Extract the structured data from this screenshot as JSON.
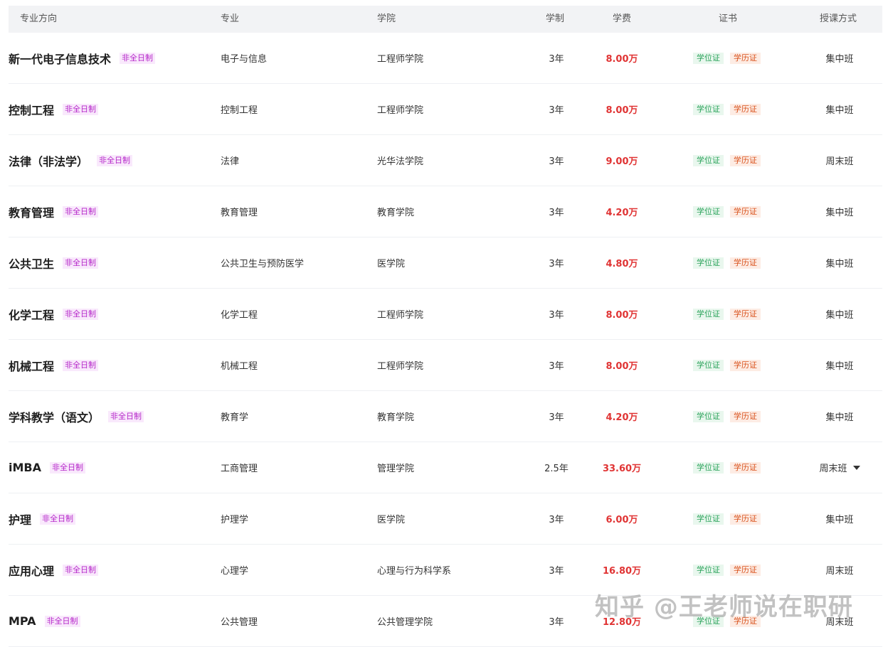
{
  "headers": {
    "direction": "专业方向",
    "major": "专业",
    "college": "学院",
    "years": "学制",
    "fee": "学费",
    "cert": "证书",
    "mode": "授课方式"
  },
  "rows": [
    {
      "direction": "新一代电子信息技术",
      "type": "非全日制",
      "major": "电子与信息",
      "college": "工程师学院",
      "years": "3年",
      "fee": "8.00万",
      "degree": "学位证",
      "edu": "学历证",
      "mode": "集中班"
    },
    {
      "direction": "控制工程",
      "type": "非全日制",
      "major": "控制工程",
      "college": "工程师学院",
      "years": "3年",
      "fee": "8.00万",
      "degree": "学位证",
      "edu": "学历证",
      "mode": "集中班"
    },
    {
      "direction": "法律（非法学）",
      "type": "非全日制",
      "major": "法律",
      "college": "光华法学院",
      "years": "3年",
      "fee": "9.00万",
      "degree": "学位证",
      "edu": "学历证",
      "mode": "周末班"
    },
    {
      "direction": "教育管理",
      "type": "非全日制",
      "major": "教育管理",
      "college": "教育学院",
      "years": "3年",
      "fee": "4.20万",
      "degree": "学位证",
      "edu": "学历证",
      "mode": "集中班"
    },
    {
      "direction": "公共卫生",
      "type": "非全日制",
      "major": "公共卫生与预防医学",
      "college": "医学院",
      "years": "3年",
      "fee": "4.80万",
      "degree": "学位证",
      "edu": "学历证",
      "mode": "集中班"
    },
    {
      "direction": "化学工程",
      "type": "非全日制",
      "major": "化学工程",
      "college": "工程师学院",
      "years": "3年",
      "fee": "8.00万",
      "degree": "学位证",
      "edu": "学历证",
      "mode": "集中班"
    },
    {
      "direction": "机械工程",
      "type": "非全日制",
      "major": "机械工程",
      "college": "工程师学院",
      "years": "3年",
      "fee": "8.00万",
      "degree": "学位证",
      "edu": "学历证",
      "mode": "集中班"
    },
    {
      "direction": "学科教学（语文）",
      "type": "非全日制",
      "major": "教育学",
      "college": "教育学院",
      "years": "3年",
      "fee": "4.20万",
      "degree": "学位证",
      "edu": "学历证",
      "mode": "集中班"
    },
    {
      "direction": "iMBA",
      "type": "非全日制",
      "major": "工商管理",
      "college": "管理学院",
      "years": "2.5年",
      "fee": "33.60万",
      "degree": "学位证",
      "edu": "学历证",
      "mode": "周末班",
      "dropdown": true
    },
    {
      "direction": "护理",
      "type": "非全日制",
      "major": "护理学",
      "college": "医学院",
      "years": "3年",
      "fee": "6.00万",
      "degree": "学位证",
      "edu": "学历证",
      "mode": "集中班"
    },
    {
      "direction": "应用心理",
      "type": "非全日制",
      "major": "心理学",
      "college": "心理与行为科学系",
      "years": "3年",
      "fee": "16.80万",
      "degree": "学位证",
      "edu": "学历证",
      "mode": "周末班"
    },
    {
      "direction": "MPA",
      "type": "非全日制",
      "major": "公共管理",
      "college": "公共管理学院",
      "years": "3年",
      "fee": "12.80万",
      "degree": "学位证",
      "edu": "学历证",
      "mode": "周末班"
    }
  ],
  "watermark": "知乎 @王老师说在职研",
  "colors": {
    "fee": "#e03434",
    "type_badge": "#b526c9",
    "degree_badge": "#2aa35a",
    "edu_badge": "#d9531e",
    "header_bg": "#f2f3f5"
  }
}
